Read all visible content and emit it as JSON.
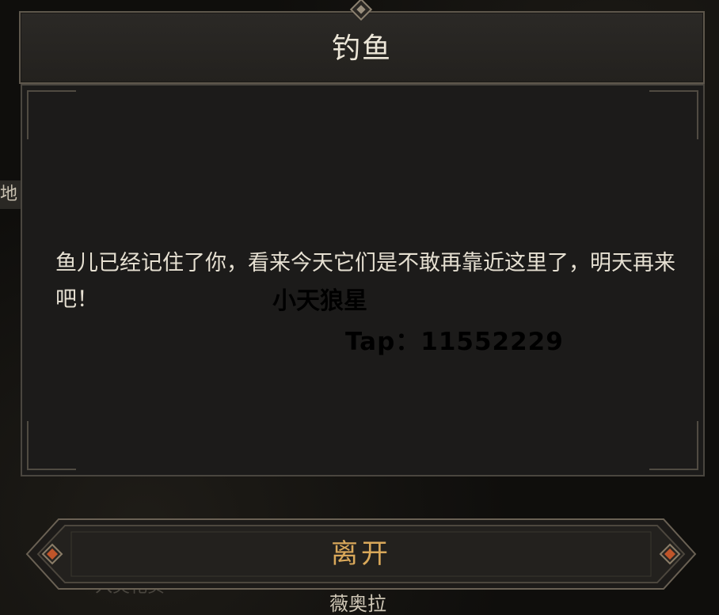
{
  "dialog": {
    "title": "钓鱼",
    "message": "鱼儿已经记住了你，看来今天它们是不敢再靠近这里了，明天再来吧！",
    "leave_label": "离开"
  },
  "overlay": {
    "name": "小天狼星",
    "tap": "Tap：11552229"
  },
  "background": {
    "left_edge_text": "地",
    "bottom_name": "薇奥拉",
    "bottom_faint_text": "入尖花买"
  },
  "colors": {
    "panel": "#1c1b1a",
    "border": "#5e574c",
    "title_text": "#ece6d8",
    "button_text": "#d9a85a",
    "gem": "#c0552a"
  }
}
